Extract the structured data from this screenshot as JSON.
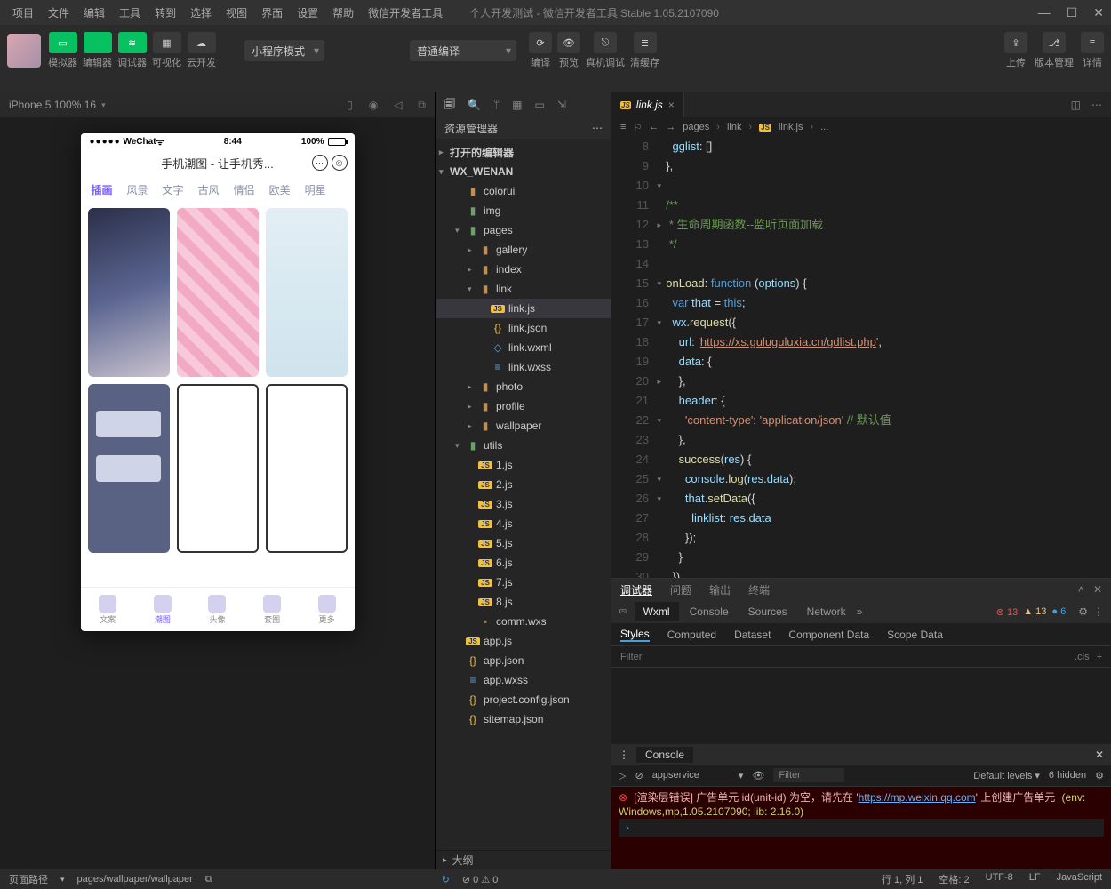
{
  "menu": [
    "项目",
    "文件",
    "编辑",
    "工具",
    "转到",
    "选择",
    "视图",
    "界面",
    "设置",
    "帮助",
    "微信开发者工具"
  ],
  "window_title": "个人开发测试 - 微信开发者工具 Stable 1.05.2107090",
  "top_buttons": [
    {
      "label": "模拟器",
      "color": "green",
      "glyph": "▭"
    },
    {
      "label": "编辑器",
      "color": "green",
      "glyph": "</>"
    },
    {
      "label": "调试器",
      "color": "green",
      "glyph": "≋"
    },
    {
      "label": "可视化",
      "color": "dark",
      "glyph": "▦"
    },
    {
      "label": "云开发",
      "color": "dark",
      "glyph": "☁"
    }
  ],
  "mode_select": "小程序模式",
  "compile_select": "普通编译",
  "mid_buttons": [
    {
      "glyph": "⟳",
      "label": "编译"
    },
    {
      "glyph": "👁",
      "label": "预览"
    },
    {
      "glyph": "⎋",
      "label": "真机调试"
    },
    {
      "glyph": "≣",
      "label": "清缓存"
    }
  ],
  "right_buttons": [
    {
      "glyph": "⇪",
      "label": "上传"
    },
    {
      "glyph": "⎇",
      "label": "版本管理"
    },
    {
      "glyph": "≡",
      "label": "详情"
    }
  ],
  "sim_header": "iPhone 5 100% 16",
  "phone": {
    "carrier": "WeChat",
    "time": "8:44",
    "battery": "100%",
    "title": "手机潮图 - 让手机秀...",
    "tabs": [
      "插画",
      "风景",
      "文字",
      "古风",
      "情侣",
      "欧美",
      "明星"
    ],
    "nav": [
      "文案",
      "潮图",
      "头像",
      "套图",
      "更多"
    ]
  },
  "explorer": {
    "title": "资源管理器",
    "sections": [
      "打开的编辑器",
      "WX_WENAN"
    ],
    "tree": [
      {
        "d": 1,
        "arr": "",
        "ico": "folder",
        "name": "colorui"
      },
      {
        "d": 1,
        "arr": "",
        "ico": "folder-g",
        "name": "img"
      },
      {
        "d": 1,
        "arr": "▾",
        "ico": "folder-g",
        "name": "pages"
      },
      {
        "d": 2,
        "arr": "▸",
        "ico": "folder",
        "name": "gallery"
      },
      {
        "d": 2,
        "arr": "▸",
        "ico": "folder",
        "name": "index"
      },
      {
        "d": 2,
        "arr": "▾",
        "ico": "folder",
        "name": "link"
      },
      {
        "d": 3,
        "arr": "",
        "ico": "js",
        "name": "link.js",
        "sel": true
      },
      {
        "d": 3,
        "arr": "",
        "ico": "json",
        "name": "link.json"
      },
      {
        "d": 3,
        "arr": "",
        "ico": "wxml",
        "name": "link.wxml"
      },
      {
        "d": 3,
        "arr": "",
        "ico": "wxss",
        "name": "link.wxss"
      },
      {
        "d": 2,
        "arr": "▸",
        "ico": "folder",
        "name": "photo"
      },
      {
        "d": 2,
        "arr": "▸",
        "ico": "folder",
        "name": "profile"
      },
      {
        "d": 2,
        "arr": "▸",
        "ico": "folder",
        "name": "wallpaper"
      },
      {
        "d": 1,
        "arr": "▾",
        "ico": "folder-g",
        "name": "utils"
      },
      {
        "d": 2,
        "arr": "",
        "ico": "js",
        "name": "1.js"
      },
      {
        "d": 2,
        "arr": "",
        "ico": "js",
        "name": "2.js"
      },
      {
        "d": 2,
        "arr": "",
        "ico": "js",
        "name": "3.js"
      },
      {
        "d": 2,
        "arr": "",
        "ico": "js",
        "name": "4.js"
      },
      {
        "d": 2,
        "arr": "",
        "ico": "js",
        "name": "5.js"
      },
      {
        "d": 2,
        "arr": "",
        "ico": "js",
        "name": "6.js"
      },
      {
        "d": 2,
        "arr": "",
        "ico": "js",
        "name": "7.js"
      },
      {
        "d": 2,
        "arr": "",
        "ico": "js",
        "name": "8.js"
      },
      {
        "d": 2,
        "arr": "",
        "ico": "wxs",
        "name": "comm.wxs"
      },
      {
        "d": 1,
        "arr": "",
        "ico": "js",
        "name": "app.js"
      },
      {
        "d": 1,
        "arr": "",
        "ico": "json",
        "name": "app.json"
      },
      {
        "d": 1,
        "arr": "",
        "ico": "wxss",
        "name": "app.wxss"
      },
      {
        "d": 1,
        "arr": "",
        "ico": "json",
        "name": "project.config.json"
      },
      {
        "d": 1,
        "arr": "",
        "ico": "json",
        "name": "sitemap.json"
      }
    ],
    "outline": "大纲"
  },
  "editor": {
    "tab": "link.js",
    "breadcrumb": [
      "pages",
      "link",
      "link.js",
      "..."
    ],
    "lines": [
      "",
      "",
      "",
      "",
      "",
      "",
      "",
      "",
      "",
      "",
      "",
      "",
      "",
      "",
      "",
      "",
      "",
      "",
      "",
      "",
      "",
      "",
      "",
      "",
      ""
    ],
    "linenums_start": 8
  },
  "debugger": {
    "tabs": [
      "调试器",
      "问题",
      "输出",
      "终端"
    ],
    "devtabs": [
      "Wxml",
      "Console",
      "Sources",
      "Network"
    ],
    "counts": {
      "err": "13",
      "wrn": "13",
      "inf": "6"
    },
    "styletabs": [
      "Styles",
      "Computed",
      "Dataset",
      "Component Data",
      "Scope Data"
    ],
    "filter": "Filter",
    "cls": ".cls",
    "console_tab": "Console",
    "context": "appservice",
    "filter2": "Filter",
    "levels": "Default levels",
    "hidden": "6 hidden",
    "error": "[渲染层错误] 广告单元 id(unit-id) 为空，请先在 '",
    "errlink": "https://mp.weixin.qq.com",
    "error2": "' 上创建广告单元",
    "env": "(env: Windows,mp,1.05.2107090; lib: 2.16.0)"
  },
  "status": {
    "left_label": "页面路径",
    "path": "pages/wallpaper/wallpaper",
    "errs": "0",
    "wrns": "0",
    "right": [
      "行 1, 列 1",
      "空格: 2",
      "UTF-8",
      "LF",
      "JavaScript"
    ]
  }
}
